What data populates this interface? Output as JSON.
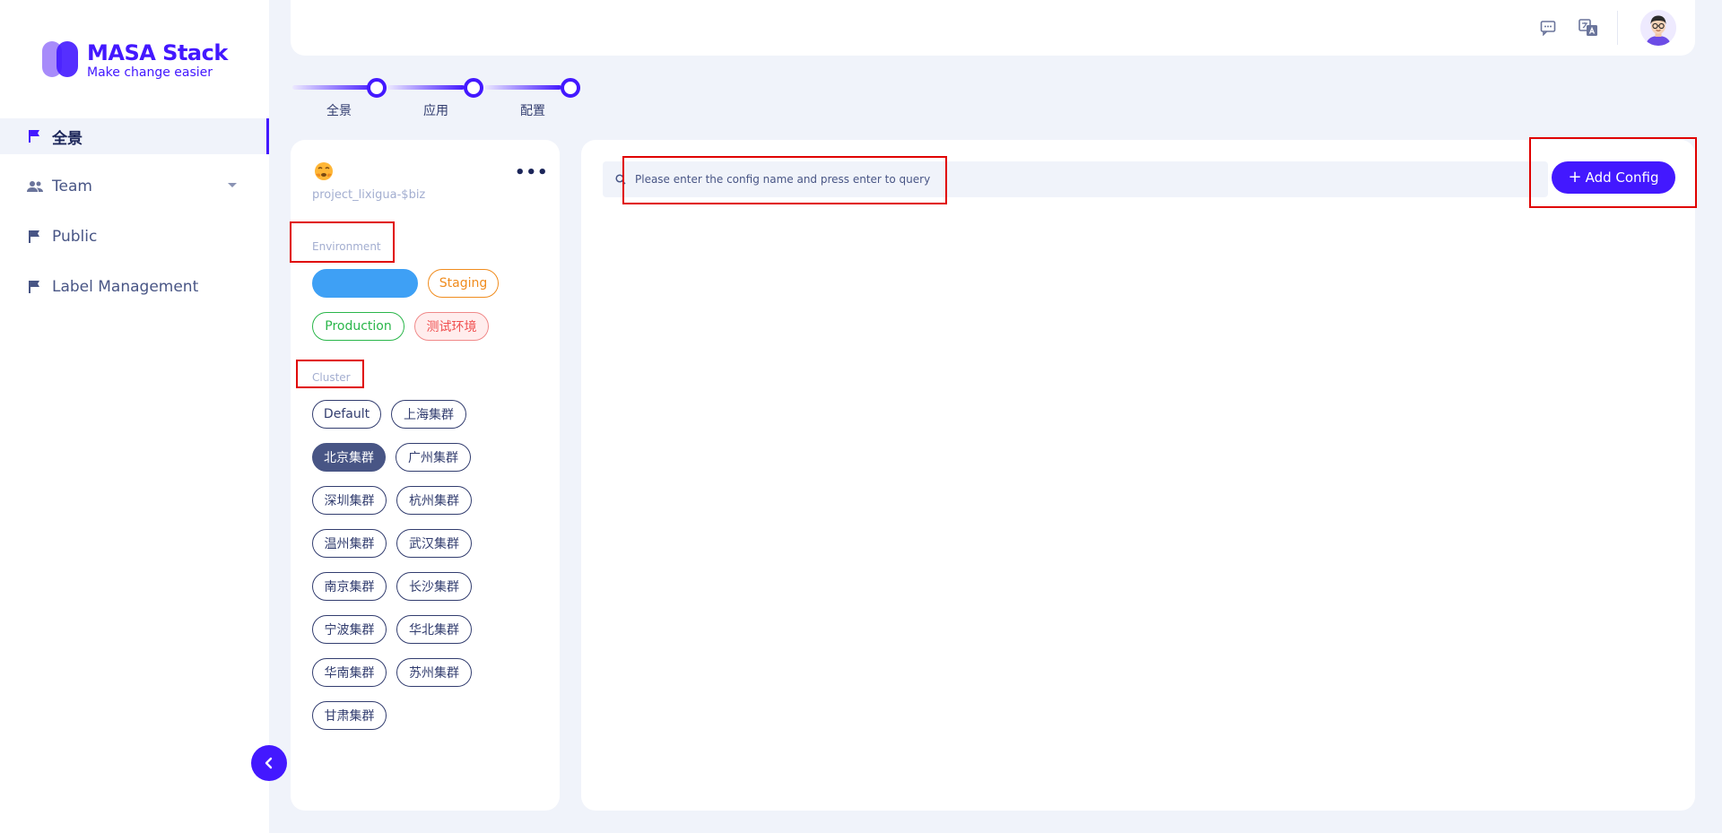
{
  "brand": {
    "title": "MASA Stack",
    "subtitle": "Make change easier"
  },
  "sidebar": {
    "items": [
      {
        "label": "全景",
        "icon": "flag-icon",
        "active": true
      },
      {
        "label": "Team",
        "icon": "team-icon",
        "has_dropdown": true
      },
      {
        "label": "Public",
        "icon": "flag-icon"
      },
      {
        "label": "Label Management",
        "icon": "flag-icon"
      }
    ]
  },
  "header": {
    "icons": [
      "message-icon",
      "translate-icon"
    ]
  },
  "stepper": {
    "steps": [
      "全景",
      "应用",
      "配置"
    ]
  },
  "project": {
    "name": "project_lixigua-$biz",
    "more": "•••",
    "environment_title": "Environment",
    "environments": [
      {
        "label": "",
        "style": "active"
      },
      {
        "label": "Staging",
        "style": "orange"
      },
      {
        "label": "Production",
        "style": "green"
      },
      {
        "label": "测试环境",
        "style": "red"
      }
    ],
    "cluster_title": "Cluster",
    "clusters": [
      "Default",
      "上海集群",
      "北京集群",
      "广州集群",
      "深圳集群",
      "杭州集群",
      "温州集群",
      "武汉集群",
      "南京集群",
      "长沙集群",
      "宁波集群",
      "华北集群",
      "华南集群",
      "苏州集群",
      "甘肃集群"
    ],
    "active_cluster": "北京集群"
  },
  "main": {
    "search_placeholder": "Please enter the config name and press enter to query",
    "add_button": "Add Config",
    "add_icon": "+"
  },
  "colors": {
    "primary": "#4318FF",
    "env_active": "#3EA0F5",
    "staging": "#F08C1E",
    "production": "#2AB64A",
    "test": "#F05050"
  }
}
